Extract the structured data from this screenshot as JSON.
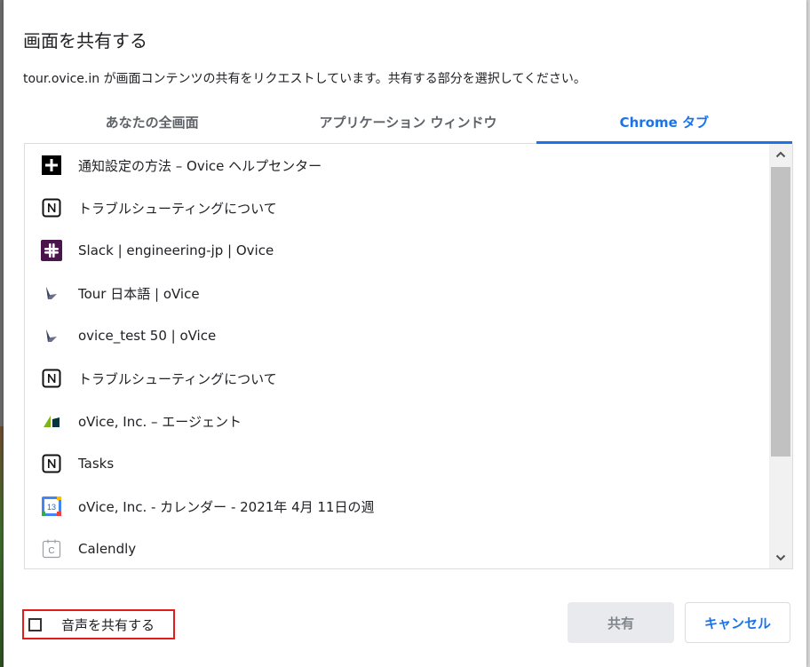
{
  "dialog": {
    "title": "画面を共有する",
    "description": "tour.ovice.in が画面コンテンツの共有をリクエストしています。共有する部分を選択してください。"
  },
  "tabs": [
    {
      "label": "あなたの全画面",
      "active": false
    },
    {
      "label": "アプリケーション ウィンドウ",
      "active": false
    },
    {
      "label": "Chrome タブ",
      "active": true
    }
  ],
  "tab_list": [
    {
      "label": "通知設定の方法 – Ovice ヘルプセンター",
      "icon": "plus-favicon-icon"
    },
    {
      "label": "トラブルシューティングについて",
      "icon": "notion-icon"
    },
    {
      "label": "Slack | engineering-jp | Ovice",
      "icon": "slack-icon"
    },
    {
      "label": "Tour 日本語 | oVice",
      "icon": "ovice-icon"
    },
    {
      "label": "ovice_test 50 | oVice",
      "icon": "ovice-icon"
    },
    {
      "label": "トラブルシューティングについて",
      "icon": "notion-icon"
    },
    {
      "label": "oVice, Inc. – エージェント",
      "icon": "zendesk-icon"
    },
    {
      "label": "Tasks",
      "icon": "notion-icon"
    },
    {
      "label": "oVice, Inc. - カレンダー - 2021年 4月 11日の週",
      "icon": "google-calendar-icon"
    },
    {
      "label": "Calendly",
      "icon": "calendly-icon"
    }
  ],
  "calendar_icon_day": "13",
  "calendly_icon_letter": "C",
  "audio": {
    "label": "音声を共有する",
    "checked": false
  },
  "buttons": {
    "share": "共有",
    "cancel": "キャンセル"
  },
  "colors": {
    "accent": "#1a73e8",
    "highlight_border": "#e21b1b"
  }
}
